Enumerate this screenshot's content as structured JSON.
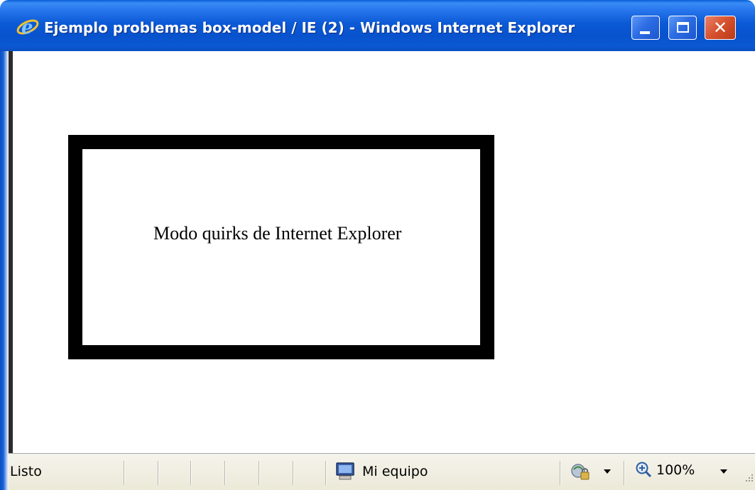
{
  "window": {
    "title": "Ejemplo problemas box-model / IE (2) - Windows Internet Explorer",
    "icon": "ie-logo-icon",
    "controls": {
      "minimize_icon": "minimize-icon",
      "maximize_icon": "maximize-icon",
      "close_icon": "close-icon",
      "close_glyph": "✕"
    }
  },
  "content": {
    "demo_text": "Modo quirks de Internet Explorer"
  },
  "statusbar": {
    "status_text": "Listo",
    "zone_icon": "computer-icon",
    "zone_text": "Mi equipo",
    "protected_mode_icon": "protected-mode-icon",
    "zoom_icon": "zoom-icon",
    "zoom_text": "100%"
  },
  "colors": {
    "titlebar": "#0b5ad6",
    "close_button": "#d6502c",
    "statusbar": "#ece9d8",
    "box_border": "#000000"
  }
}
